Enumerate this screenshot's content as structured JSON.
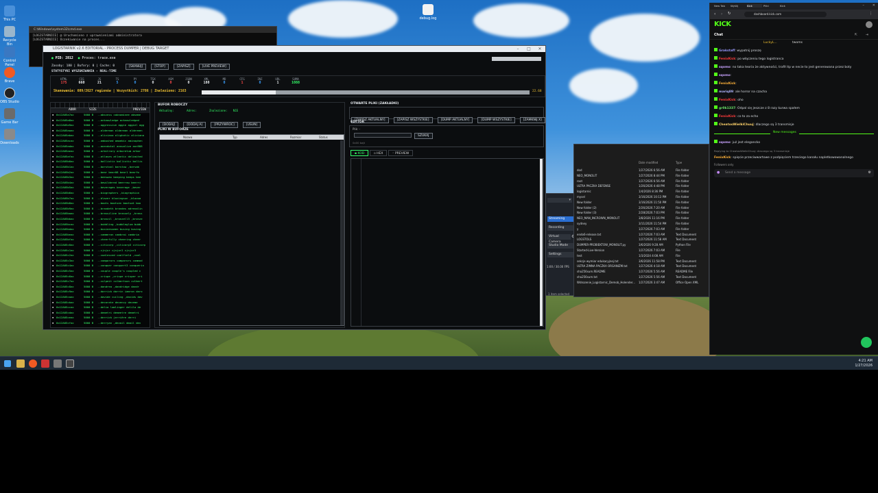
{
  "desktop": {
    "icons": [
      "This PC",
      "Recycle Bin",
      "Control Panel",
      "Brave",
      "OBS Studio",
      "Game Bar",
      "Downloads"
    ],
    "file_icon_label": "debug.log"
  },
  "taskbar": {
    "time": "4:21 AM",
    "date": "1/27/2026"
  },
  "console_window": {
    "title": "C:\\Windows\\system32\\cmd.exe",
    "lines": [
      "[LOGISTARNICE] @ Uruchomiono z uprawnieniami administratora",
      "[LOGISTARNICE] Oczekiwanie na proces..."
    ]
  },
  "app": {
    "title": "LOGISTARNIK v2.6 EDITORIAL - PROCESS DUMPER | DEBUG TARGET",
    "pid_label": "PID: 2812",
    "process_label": "Proces: trace.exe",
    "toolbar": [
      "[SKANUJ]",
      "[STOP]",
      "[ZAPISZ]",
      "[LIVE PREVIEW]"
    ],
    "info_line": "Zasoby: 180 | Bufory: 0 | Cache: 0",
    "stats_title": "STATYSTYKI WYSZUKIWANIA - REAL-TIME",
    "stats": [
      {
        "label": "HTML",
        "value": "175",
        "color": "#ff4a4a"
      },
      {
        "label": "CSS",
        "value": "660",
        "color": "#e9edf0"
      },
      {
        "label": "JS",
        "value": "21",
        "color": "#e9edf0"
      },
      {
        "label": "TS",
        "value": "5",
        "color": "#3aa0ff"
      },
      {
        "label": "PY",
        "value": "0",
        "color": "#3aa0ff"
      },
      {
        "label": "TSX",
        "value": "0",
        "color": "#e9edf0"
      },
      {
        "label": "ASM",
        "value": "0",
        "color": "#ff4a4a"
      },
      {
        "label": "JSON",
        "value": "0",
        "color": "#e9edf0"
      },
      {
        "label": "XML",
        "value": "180",
        "color": "#e9edf0"
      },
      {
        "label": "MD",
        "value": "0",
        "color": "#3aa0ff"
      },
      {
        "label": "CFG",
        "value": "1",
        "color": "#ff4a4a"
      },
      {
        "label": "INI",
        "value": "0",
        "color": "#3aa0ff"
      },
      {
        "label": "URL",
        "value": "1",
        "color": "#e9edf0"
      },
      {
        "label": "SUMA",
        "value": "1088",
        "color": "#35ff6a"
      }
    ],
    "scan_status": "Skanowanie: 609/2627 regionów | Wszystkich: 2786 | Znaleziono: 2163",
    "progress_fraction": 0.2268,
    "progress_text": "22.68",
    "list_headers": [
      "ADDR",
      "SIZE",
      "PREVIEW"
    ],
    "list_rows": [
      {
        "addr": "0x12A05a7ac",
        "size": "5000 B",
        "preview": "..abscess cabnominee abseme"
      },
      {
        "addr": "0x12A05a8ac",
        "size": "5000 B",
        "preview": "..acknowledge acknowledged"
      },
      {
        "addr": "0x12A05a9ac",
        "size": "5000 B",
        "preview": "..aggressive aggie aggiel agg"
      },
      {
        "addr": "0x12A05aaac",
        "size": "5000 B",
        "preview": "..alderman alderman aldermen"
      },
      {
        "addr": "0x12A05abac",
        "size": "5000 B",
        "preview": "..aliciana alighatic aliciana"
      },
      {
        "addr": "0x12A05acac",
        "size": "5000 B",
        "preview": "..ambushed amoebic aminophen"
      },
      {
        "addr": "0x12A05adac",
        "size": "5000 B",
        "preview": "..anecdotal annualize ann988"
      },
      {
        "addr": "0x12A05aeac",
        "size": "5000 B",
        "preview": "..arbitrary arboretum arbor"
      },
      {
        "addr": "0x12A05afac",
        "size": "5000 B",
        "preview": "..atlases atlantic delimited"
      },
      {
        "addr": "0x12A05b0ac",
        "size": "5000 B",
        "preview": "..ballistic ballistic ballis"
      },
      {
        "addr": "0x12A05b1ac",
        "size": "5000 B",
        "preview": "..barstool barstow ,barsab"
      },
      {
        "addr": "0x12A05b2ac",
        "size": "5000 B",
        "preview": "..bear bear08 bear1 bearfo"
      },
      {
        "addr": "0x12A05b3ac",
        "size": "5000 B",
        "preview": "..beeswax beeping beeps bee"
      },
      {
        "addr": "0x12A05b4ac",
        "size": "5000 B",
        "preview": "..bewildered beerrow beerri"
      },
      {
        "addr": "0x12A05b5ac",
        "size": "5000 B",
        "preview": "..beverages beverage ,bever"
      },
      {
        "addr": "0x12A05b6ac",
        "size": "5000 B",
        "preview": "..biographers ,biographica"
      },
      {
        "addr": "0x12A05b7ac",
        "size": "5000 B",
        "preview": "..blazer blazingsun ,blazoa"
      },
      {
        "addr": "0x12A05b8ac",
        "size": "5000 B",
        "preview": "..boots bootsen bootsat boo"
      },
      {
        "addr": "0x12A05b9ac",
        "size": "5000 B",
        "preview": "..brandeth brandes adrenalin"
      },
      {
        "addr": "0x12A05baac",
        "size": "5000 B",
        "preview": "..brassiline brassely ,brass"
      },
      {
        "addr": "0x12A05bbac",
        "size": "5000 B",
        "preview": "..bronzil ,bronzell3 ,bronze"
      },
      {
        "addr": "0x12A05bcac",
        "size": "5000 B",
        "preview": "..bubbling ,bubbleglum bubb"
      },
      {
        "addr": "0x12A05bdac",
        "size": "5000 B",
        "preview": "..businessmen busing busing"
      },
      {
        "addr": "0x12A05beac",
        "size": "5000 B",
        "preview": "..cammeron cambrai cambria"
      },
      {
        "addr": "0x12A05bfac",
        "size": "5000 B",
        "preview": "..cheerfully cheering cheer"
      },
      {
        "addr": "0x12A05c0ac",
        "size": "5000 B",
        "preview": "..citicorp ,citicorp3 citicorp"
      },
      {
        "addr": "0x12A05c1ac",
        "size": "5000 B",
        "preview": "..cjnjxr cjnjxr2 cjnjxr3"
      },
      {
        "addr": "0x12A05c2ac",
        "size": "5000 B",
        "preview": "..coalesced coalfield ,coal"
      },
      {
        "addr": "0x12A05c3ac",
        "size": "5000 B",
        "preview": "..comparors comparors commod"
      },
      {
        "addr": "0x12A05c4ac",
        "size": "5000 B",
        "preview": "..conquer conquert3 conquerin"
      },
      {
        "addr": "0x12A05c5ac",
        "size": "5000 B",
        "preview": "..couple couple's coupled c"
      },
      {
        "addr": "0x12A05c6ac",
        "size": "5000 B",
        "preview": "..crispe ,crispe crisper cri"
      },
      {
        "addr": "0x12A05c7ac",
        "size": "5000 B",
        "preview": "..culpeit culbertson culbert"
      },
      {
        "addr": "0x12A05c8ac",
        "size": "5000 B",
        "preview": "..dandrea ,dandridge dandr"
      },
      {
        "addr": "0x12A05c9ac",
        "size": "5000 B",
        "preview": "..darrick darrin iamron daro"
      },
      {
        "addr": "0x12A05caac",
        "size": "5000 B",
        "preview": "..davide cuiling ,davids dav"
      },
      {
        "addr": "0x12A05cbac",
        "size": "5000 B",
        "preview": "..decorate decency deceme"
      },
      {
        "addr": "0x12A05ccac",
        "size": "5000 B",
        "preview": "..delia lamlinger delila de"
      },
      {
        "addr": "0x12A05cdac",
        "size": "5000 B",
        "preview": "..demetri demeetre demetri"
      },
      {
        "addr": "0x12A05ceac",
        "size": "5000 B",
        "preview": "..derrick jerrière derri"
      },
      {
        "addr": "0x12A05cfac",
        "size": "5000 B",
        "preview": "..derryan ,devail dmail dev"
      }
    ],
    "buffer": {
      "title": "BUFOR ROBOCZY",
      "row_labels": [
        "Aktualny:",
        "Adres:",
        "Znalezione:",
        "NIE"
      ],
      "buttons": [
        "[DODAJ]",
        "[DODAJ A]",
        "[PRZYWROC]",
        "[USUN]"
      ],
      "files_title": "PLIKI W BUFORZE",
      "headers": [
        "Nazwa",
        "Typ",
        "Adres",
        "Rozmiar",
        "Status"
      ]
    },
    "open_files": {
      "title": "OTWARTE PLIKI (ZAKŁADKI)",
      "buttons": [
        "[ZAPISZ AKTUALNY]",
        "[ZAPISZ WSZYSTKIE]",
        "[DUMP AKTUALNY]",
        "[DUMP WSZYSTKIE]",
        "[ZAMKNIJ X]"
      ]
    },
    "editor": {
      "title": "EDYTOR",
      "file_label": "Plik: -",
      "search_button": "SZUKAJ",
      "search_placeholder": "",
      "hint": "0x00 bajt",
      "tabs": [
        "KOD",
        "HEX",
        "PREVIEW"
      ]
    }
  },
  "obs_panel": {
    "items": [
      "Streaming",
      "Recording",
      "Virtual Camera",
      "Studio Mode",
      "Settings"
    ],
    "fps": "1:00 / 30.00 FPS"
  },
  "explorer": {
    "header_dm": "Date modified",
    "header_type": "Type",
    "rows": [
      {
        "name": "dod",
        "date": "1/27/2026 6:56 AM",
        "type": "File folder"
      },
      {
        "name": "NEO_MONOLIT",
        "date": "1/27/2026 8:44 PM",
        "type": "File folder"
      },
      {
        "name": "root",
        "date": "1/27/2026 6:56 AM",
        "type": "File folder"
      },
      {
        "name": "ULTRA PACZKA DEFENSE",
        "date": "1/26/2026 4:48 PM",
        "type": "File folder"
      },
      {
        "name": "logistarnic",
        "date": "1/4/2026 8:36 PM",
        "type": "File folder"
      },
      {
        "name": "mysel",
        "date": "3/16/2026 10:13 PM",
        "type": "File folder"
      },
      {
        "name": "New folder",
        "date": "3/16/2026 11:50 PM",
        "type": "File folder"
      },
      {
        "name": "New folder (2)",
        "date": "2/26/2026 7:20 AM",
        "type": "File folder"
      },
      {
        "name": "New folder (3)",
        "date": "2/28/2026 7:03 PM",
        "type": "File folder"
      },
      {
        "name": "NEO_MAN_INCROWN_MONOLIT",
        "date": "3/8/2026 11:16 PM",
        "type": "File folder"
      },
      {
        "name": "sydney",
        "date": "3/11/2026 11:54 PM",
        "type": "File folder"
      },
      {
        "name": "y",
        "date": "1/27/2026 7:03 AM",
        "type": "File folder"
      },
      {
        "name": "endo6-release.txt",
        "date": "1/27/2026 7:03 AM",
        "type": "Text Document"
      },
      {
        "name": "LOGSTOLS",
        "date": "1/27/2026 11:58 AM",
        "type": "Text Document"
      },
      {
        "name": "DUMPER-PROBIEKTOW_MONOLIT.py",
        "date": "3/6/2026 9:28 AM",
        "type": "Python File"
      },
      {
        "name": "Started-Live-Version",
        "date": "1/27/2026 7:03 AM",
        "type": "File"
      },
      {
        "name": "test",
        "date": "1/3/2024 4:08 AM",
        "type": "File"
      },
      {
        "name": "sekcje wymiar edukacyjnej.txt",
        "date": "3/6/2026 11:58 PM",
        "type": "Text Document"
      },
      {
        "name": "ULTRA ZIMNA PACZKA ORGANIZM.txt",
        "date": "1/27/2026 4:18 AM",
        "type": "Text Document"
      },
      {
        "name": "sha256sum.README",
        "date": "1/27/2026 5:56 AM",
        "type": "README File"
      },
      {
        "name": "sha256sum.txt",
        "date": "1/27/2026 5:56 AM",
        "type": "Text Document"
      },
      {
        "name": "Wdrozenie_Logistarnic_Demob_Holender...",
        "date": "1/27/2026 3:47 AM",
        "type": "Office Open XML"
      }
    ],
    "status": "1 item selected"
  },
  "browser": {
    "tabs": [
      "New Tab",
      "Wyślij",
      "Kick",
      "Pliki",
      "Kick"
    ],
    "url": "dashboard.kick.com",
    "logo": "KICK",
    "chat_title": "Chat",
    "viewers": "LuckyL...",
    "viewer_count": "twoms",
    "messages": [
      {
        "user": "Grakstaff",
        "color": "#9a9aff",
        "text": "wypatnij proszę"
      },
      {
        "user": "FenixKick",
        "color": "#ff3b3b",
        "text": "po włączeniu tego logistranca"
      },
      {
        "user": "sqomo",
        "color": "#c9a3ff",
        "text": "no taka teoria że aktywności, trafił itp w necie to jest generowana przez boty"
      },
      {
        "user": "sqomo",
        "color": "#c9a3ff",
        "text": ""
      },
      {
        "user": "FenixKick",
        "color": "#ffb23a",
        "text": ""
      },
      {
        "user": "mariq89",
        "color": "#b0b6ff",
        "text": "ale horror na czacha"
      },
      {
        "user": "FenixKick",
        "color": "#ff3b3b",
        "text": "oho"
      },
      {
        "user": "gr0k1337",
        "color": "#6be86b",
        "text": "Odpal się jeszcze z 8 razy kurwa spałem"
      },
      {
        "user": "FenixKick",
        "color": "#ff3b3b",
        "text": "co to za echo"
      },
      {
        "user": "CheatosWielkiChuuj",
        "color": "#ffd36b",
        "text": "dlaczego są 3 transmisje"
      }
    ],
    "new_messages": "New messages",
    "after_messages": [
      {
        "user": "sqomo",
        "color": "#c9a3ff",
        "text": "już jest elegancko"
      }
    ],
    "reply_note": "Replying to CheatosWielkiChuuj: dlaczego są 3 transmisje",
    "reply_message": {
      "user": "FenixKick",
      "color": "#ffb23a",
      "text": "spięcie przeciwwartowe z podpięciem trzeciego kanału napletkowowanalnego"
    },
    "followers_only": "Followers only",
    "send_placeholder": "Send a message"
  }
}
